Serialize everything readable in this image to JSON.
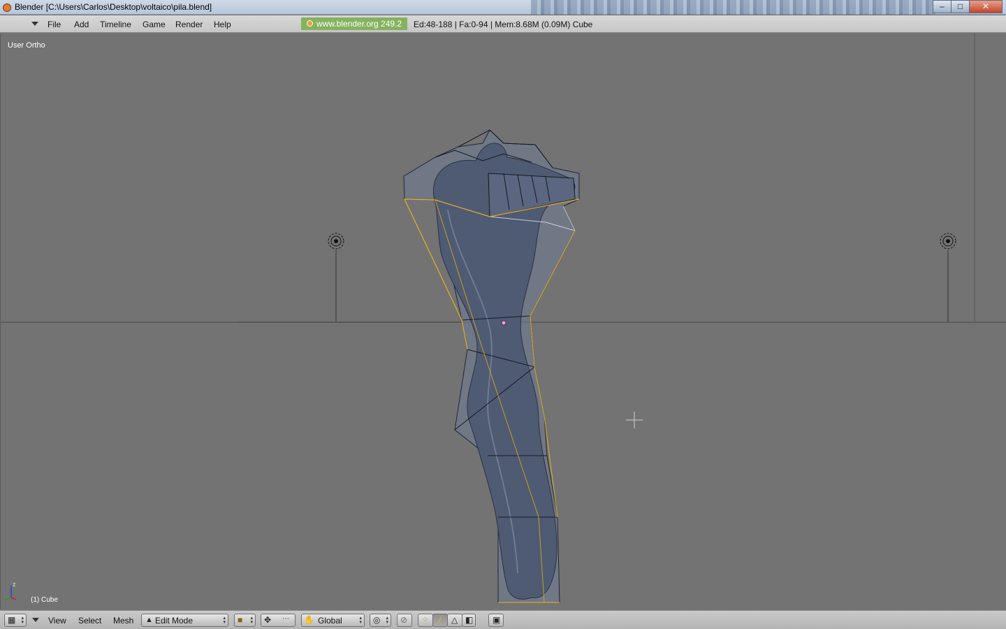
{
  "window": {
    "title": "Blender [C:\\Users\\Carlos\\Desktop\\voltaico\\pila.blend]",
    "controls": {
      "minimize": "–",
      "maximize": "□",
      "close": "✕"
    }
  },
  "menubar": {
    "items": [
      "File",
      "Add",
      "Timeline",
      "Game",
      "Render",
      "Help"
    ],
    "splash": "www.blender.org 249.2",
    "stats": "Ed:48-188 | Fa:0-94 | Mem:8.68M (0.09M) Cube"
  },
  "viewport": {
    "view_label": "User Ortho",
    "object_label": "(1) Cube",
    "axis_label": "z",
    "colors": {
      "background": "#737373",
      "mesh_fill": "#5b6a86",
      "selected_edge": "#e8b020"
    }
  },
  "bottombar": {
    "view": "View",
    "select": "Select",
    "mesh": "Mesh",
    "mode": "Edit Mode",
    "orientation": "Global",
    "icons": [
      "grid-icon",
      "mode-icon",
      "draw-type-icon",
      "pivot-icon",
      "manipulator-icon",
      "hand-icon",
      "proportional-icon",
      "snap-icon",
      "vertex-select-icon",
      "edge-select-icon",
      "face-select-icon",
      "occlude-icon",
      "render-icon"
    ]
  }
}
